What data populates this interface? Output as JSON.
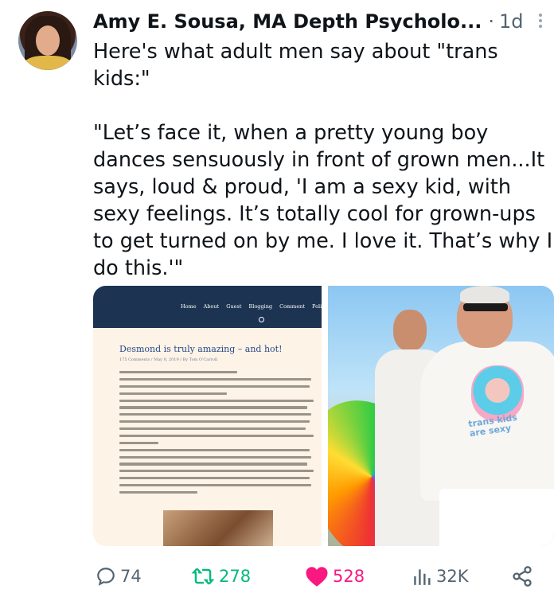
{
  "author": {
    "display_name": "Amy E. Sousa, MA Depth Psycholo...",
    "separator": "·",
    "timestamp": "1d"
  },
  "tweet": {
    "text": "Here's what adult men say about \"trans kids:\"\n\n\"Let’s face it, when a pretty young boy dances sensuously in front of grown men...It says, loud & proud, 'I am a sexy kid, with sexy feelings. It’s totally cool for grown-ups to get turned on by me. I love it. That’s why I do this.'\""
  },
  "media": {
    "blog": {
      "nav_items": "Home About Guest Blogging Comment Policy",
      "title": "Desmond is truly amazing – and hot!",
      "meta": "175 Comments / May 8, 2019 / By Tom O'Carroll"
    },
    "photo": {
      "shirt_text": "trans kids\nare sexy"
    }
  },
  "actions": {
    "replies": "74",
    "reposts": "278",
    "likes": "528",
    "views": "32K"
  },
  "colors": {
    "repost": "#00ba7c",
    "like": "#f91880",
    "muted": "#536471"
  }
}
